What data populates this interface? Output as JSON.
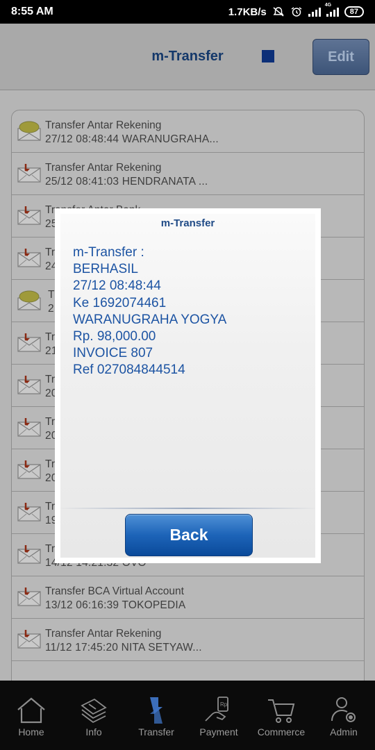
{
  "status_bar": {
    "time": "8:55 AM",
    "network_speed": "1.7KB/s",
    "network_type": "4G",
    "battery": "87"
  },
  "header": {
    "title": "m-Transfer",
    "edit_label": "Edit"
  },
  "list": {
    "items": [
      {
        "line1": "Transfer Antar Rekening",
        "line2": "27/12 08:48:44 WARANUGRAHA...",
        "icon": "open-envelope-icon"
      },
      {
        "line1": "Transfer Antar Rekening",
        "line2": "25/12 08:41:03 HENDRANATA ...",
        "icon": "envelope-icon"
      },
      {
        "line1": "Transfer Antar Bank",
        "line2": "25",
        "icon": "envelope-icon"
      },
      {
        "line1": "Tr",
        "line2": "24",
        "icon": "envelope-icon"
      },
      {
        "line1": "T",
        "line2": "2",
        "icon": "open-envelope-icon"
      },
      {
        "line1": "Tr",
        "line2": "21",
        "icon": "envelope-icon"
      },
      {
        "line1": "Tr",
        "line2": "20",
        "icon": "envelope-icon"
      },
      {
        "line1": "Tr",
        "line2": "20",
        "icon": "envelope-icon"
      },
      {
        "line1": "Tr",
        "line2": "20",
        "icon": "envelope-icon"
      },
      {
        "line1": "Tr",
        "line2": "19",
        "icon": "envelope-icon"
      },
      {
        "line1": "Tr",
        "line2": "14/12 14:21:32 OVO",
        "icon": "envelope-icon"
      },
      {
        "line1": "Transfer BCA Virtual Account",
        "line2": "13/12 06:16:39 TOKOPEDIA",
        "icon": "envelope-icon"
      },
      {
        "line1": "Transfer Antar Rekening",
        "line2": "11/12 17:45:20 NITA SETYAW...",
        "icon": "envelope-icon"
      }
    ]
  },
  "dialog": {
    "title": "m-Transfer",
    "message_lines": [
      "m-Transfer :",
      "BERHASIL",
      "27/12 08:48:44",
      "Ke 1692074461",
      "WARANUGRAHA YOGYA",
      "Rp. 98,000.00",
      "INVOICE 807",
      "Ref 027084844514"
    ],
    "back_label": "Back"
  },
  "bottom_nav": {
    "items": [
      {
        "label": "Home",
        "icon": "home-icon"
      },
      {
        "label": "Info",
        "icon": "info-book-icon"
      },
      {
        "label": "Transfer",
        "icon": "transfer-arrows-icon"
      },
      {
        "label": "Payment",
        "icon": "payment-hand-icon"
      },
      {
        "label": "Commerce",
        "icon": "shopping-cart-icon"
      },
      {
        "label": "Admin",
        "icon": "admin-user-gear-icon"
      }
    ],
    "active": "Transfer",
    "active_color": "#3f74c4",
    "inactive_color": "#9a9a9a"
  },
  "colors": {
    "dialog_text": "#1d54a3",
    "header_title": "#14386a",
    "back_button": "#1d64b8"
  }
}
